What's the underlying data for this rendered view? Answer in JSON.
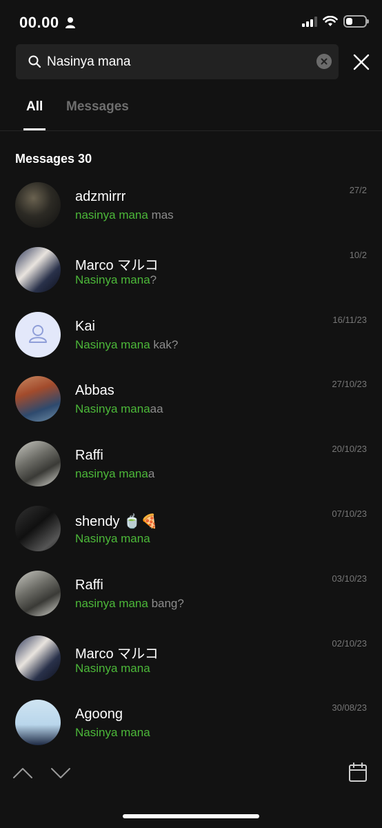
{
  "status_bar": {
    "time": "00.00"
  },
  "search": {
    "value": "Nasinya mana"
  },
  "tabs": [
    {
      "label": "All",
      "active": true
    },
    {
      "label": "Messages",
      "active": false
    }
  ],
  "section": {
    "title": "Messages 30"
  },
  "results": [
    {
      "name": "adzmirrr",
      "highlight": "nasinya mana",
      "rest": " mas",
      "date": "27/2",
      "avatar": "city-night-photo"
    },
    {
      "name": "Marco マルコ",
      "highlight": "Nasinya mana",
      "rest": "?",
      "date": "10/2",
      "avatar": "anime-character"
    },
    {
      "name": "Kai",
      "highlight": "Nasinya mana",
      "rest": " kak?",
      "date": "16/11/23",
      "avatar": "default-person-icon"
    },
    {
      "name": "Abbas",
      "highlight": "Nasinya mana",
      "rest": "aa",
      "date": "27/10/23",
      "avatar": "couple-illustration"
    },
    {
      "name": "Raffi",
      "highlight": "nasinya mana",
      "rest": "a",
      "date": "20/10/23",
      "avatar": "person-photo"
    },
    {
      "name": "shendy 🍵🍕",
      "highlight": "Nasinya mana",
      "rest": "",
      "date": "07/10/23",
      "avatar": "dark-photo"
    },
    {
      "name": "Raffi",
      "highlight": "nasinya mana",
      "rest": " bang?",
      "date": "03/10/23",
      "avatar": "person-photo"
    },
    {
      "name": "Marco マルコ",
      "highlight": "Nasinya mana",
      "rest": "",
      "date": "02/10/23",
      "avatar": "anime-character"
    },
    {
      "name": "Agoong",
      "highlight": "Nasinya mana",
      "rest": "",
      "date": "30/08/23",
      "avatar": "anime-boy"
    }
  ],
  "colors": {
    "highlight": "#4cb839",
    "background": "#121212"
  }
}
